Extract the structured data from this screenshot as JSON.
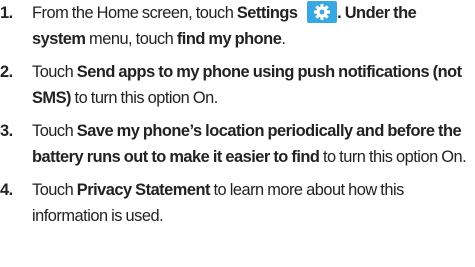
{
  "steps": [
    {
      "number": "1.",
      "parts": {
        "t1": "From the Home screen, touch ",
        "b1": "Settings",
        "t2": ". Under the",
        "b2": "system",
        "t3": " menu, touch ",
        "b3": "find my phone",
        "t4": "."
      },
      "icon": "settings-gear-icon",
      "icon_color": "#38a8e0"
    },
    {
      "number": "2.",
      "parts": {
        "t1": "Touch ",
        "b1": "Send apps to my phone using push notifications (not SMS)",
        "t2": " to turn this option On."
      }
    },
    {
      "number": "3.",
      "parts": {
        "t1": "Touch ",
        "b1": "Save my phone’s location periodically and before the battery runs out to make it easier to find",
        "t2": " to turn this option On."
      }
    },
    {
      "number": "4.",
      "parts": {
        "t1": "Touch ",
        "b1": "Privacy Statement",
        "t2": " to learn more about how this information is used."
      }
    }
  ]
}
